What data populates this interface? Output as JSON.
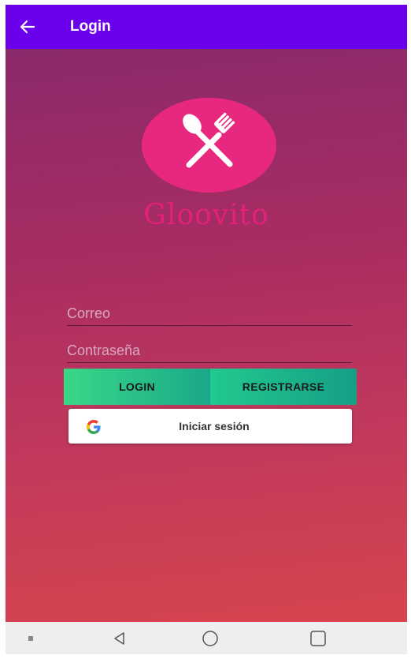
{
  "appbar": {
    "title": "Login",
    "back_icon": "arrow-left-icon",
    "color": "#6a00ec"
  },
  "logo": {
    "brand_name": "Gloovito",
    "icon": "spoon-fork-icon",
    "circle_color": "#e8287e"
  },
  "form": {
    "email_placeholder": "Correo",
    "email_value": "",
    "password_placeholder": "Contraseña",
    "password_value": ""
  },
  "buttons": {
    "login_label": "LOGIN",
    "register_label": "REGISTRARSE",
    "google_label": "Iniciar sesión",
    "google_icon": "google-icon"
  },
  "navbar": {
    "items": [
      "recents-dot-icon",
      "back-triangle-icon",
      "home-circle-icon",
      "overview-square-icon"
    ]
  }
}
